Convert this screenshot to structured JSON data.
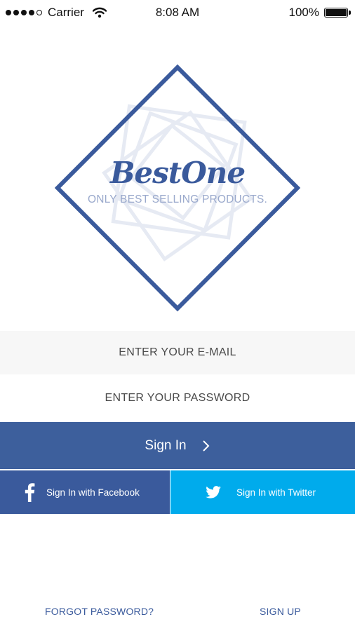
{
  "status_bar": {
    "carrier": "Carrier",
    "time": "8:08 AM",
    "battery_text": "100%",
    "battery_level": 1.0,
    "signal_bars": 4
  },
  "logo": {
    "brand": "BestOne",
    "tagline": "ONLY BEST SELLING PRODUCTS."
  },
  "form": {
    "email_placeholder": "ENTER YOUR E-MAIL",
    "password_placeholder": "ENTER YOUR PASSWORD",
    "signin_label": "Sign In"
  },
  "social": {
    "facebook_label": "Sign In with Facebook",
    "twitter_label": "Sign In with Twitter"
  },
  "footer": {
    "forgot_label": "FORGOT PASSWORD?",
    "signup_label": "SIGN UP"
  },
  "colors": {
    "brand_blue": "#3a5a9c",
    "signin_blue": "#3d5f9c",
    "twitter_blue": "#00abec",
    "input_bg": "#f7f7f7"
  },
  "icons": [
    "wifi-icon",
    "battery-icon",
    "chevron-right-icon",
    "facebook-icon",
    "twitter-icon"
  ]
}
